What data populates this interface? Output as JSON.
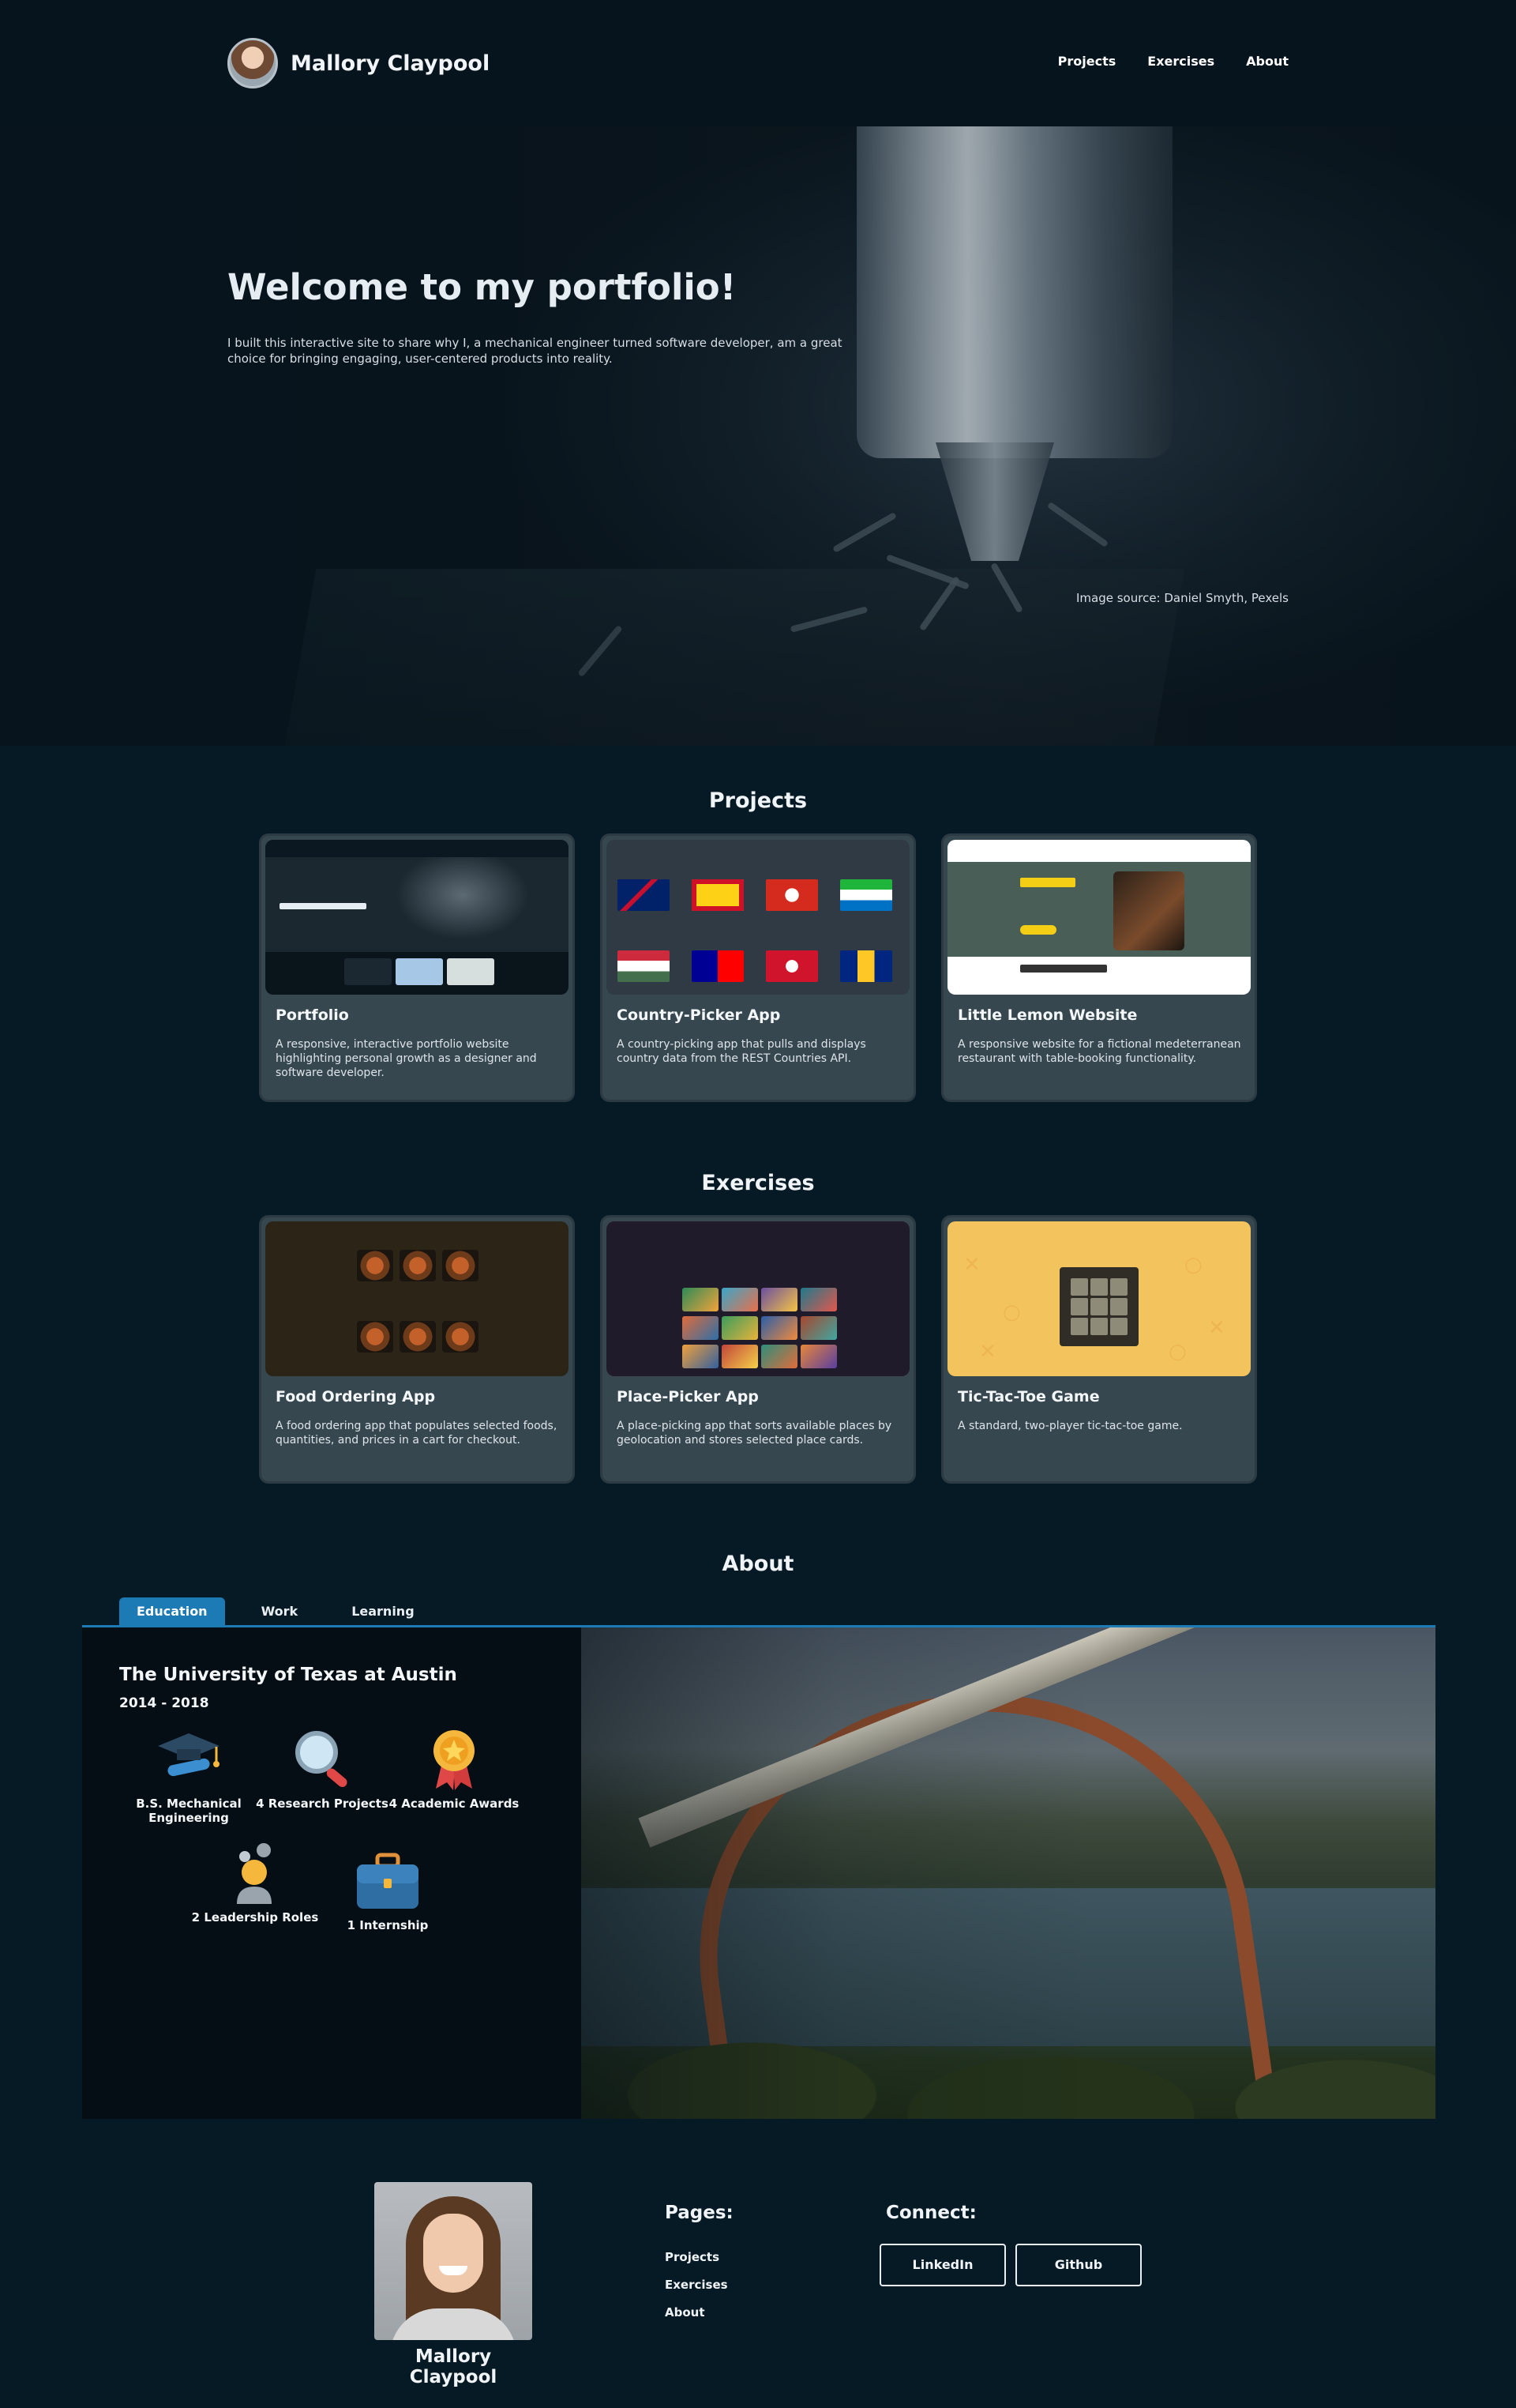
{
  "header": {
    "name": "Mallory Claypool",
    "nav": [
      "Projects",
      "Exercises",
      "About"
    ]
  },
  "hero": {
    "title": "Welcome to my portfolio!",
    "text": "I built this interactive site to share why I, a mechanical engineer turned software developer, am a great choice for bringing engaging, user-centered products into reality.",
    "credit": "Image source: Daniel Smyth, Pexels"
  },
  "projects": {
    "title": "Projects",
    "cards": [
      {
        "title": "Portfolio",
        "desc": "A responsive, interactive portfolio website highlighting personal growth as a designer and software developer."
      },
      {
        "title": "Country-Picker App",
        "desc": "A country-picking app that pulls and displays country data from the REST Countries API."
      },
      {
        "title": "Little Lemon Website",
        "desc": "A responsive website for a fictional medeterranean restaurant with table-booking functionality."
      }
    ]
  },
  "exercises": {
    "title": "Exercises",
    "cards": [
      {
        "title": "Food Ordering App",
        "desc": "A food ordering app that populates selected foods, quantities, and prices in a cart for checkout."
      },
      {
        "title": "Place-Picker App",
        "desc": "A place-picking app that sorts available places by geolocation and stores selected place cards."
      },
      {
        "title": "Tic-Tac-Toe Game",
        "desc": "A standard, two-player tic-tac-toe game."
      }
    ]
  },
  "about": {
    "title": "About",
    "tabs": [
      "Education",
      "Work",
      "Learning"
    ],
    "active_tab": "Education",
    "institution": "The University of Texas at Austin",
    "years": "2014 - 2018",
    "achievements": [
      {
        "label": "B.S. Mechanical Engineering",
        "icon": "graduation-cap-icon"
      },
      {
        "label": "4 Research Projects",
        "icon": "magnifier-icon"
      },
      {
        "label": "4 Academic Awards",
        "icon": "medal-icon"
      },
      {
        "label": "2 Leadership Roles",
        "icon": "leader-icon"
      },
      {
        "label": "1 Internship",
        "icon": "briefcase-icon"
      }
    ]
  },
  "footer": {
    "name": "Mallory Claypool",
    "pages_title": "Pages:",
    "pages": [
      "Projects",
      "Exercises",
      "About"
    ],
    "connect_title": "Connect:",
    "connect": [
      "LinkedIn",
      "Github"
    ]
  },
  "colors": {
    "background": "#061a26",
    "card": "#374750",
    "accent": "#1c7ab4"
  }
}
